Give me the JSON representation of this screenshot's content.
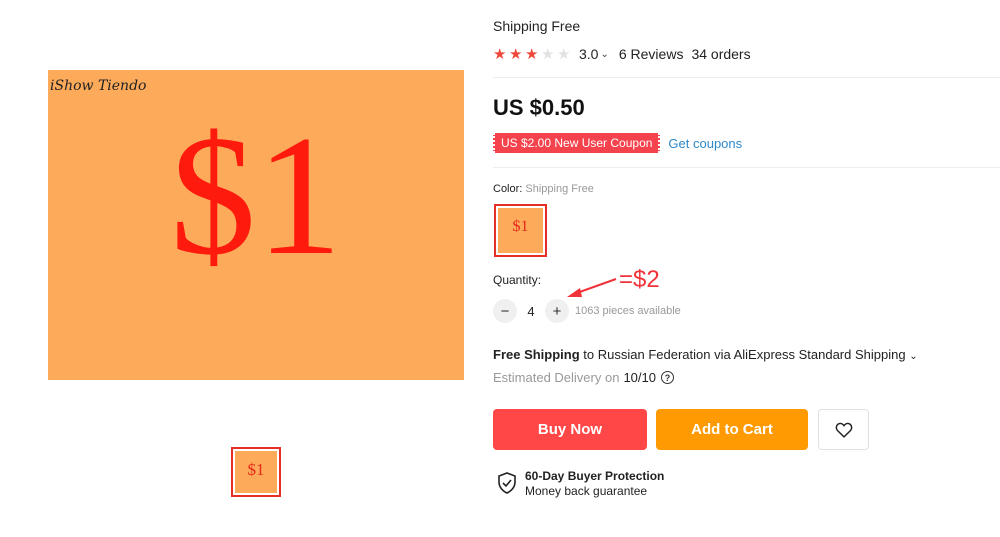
{
  "gallery": {
    "brand_text": "iShow Tiendo",
    "main_price_text": "$1",
    "thumb_price_text": "$1"
  },
  "product": {
    "title": "Shipping Free",
    "rating": {
      "stars_filled": 3,
      "stars_total": 5,
      "value": "3.0",
      "reviews": "6 Reviews",
      "orders": "34 orders"
    },
    "price": "US $0.50",
    "coupon": {
      "label": "US $2.00 New User Coupon",
      "link": "Get coupons"
    }
  },
  "color": {
    "label": "Color:",
    "value": "Shipping Free",
    "sku_text": "$1"
  },
  "quantity": {
    "label": "Quantity:",
    "minus": "−",
    "value": "4",
    "plus": "+",
    "available": "1063 pieces available",
    "annotation": "=$2"
  },
  "shipping": {
    "free_label": "Free Shipping",
    "detail": " to Russian Federation via AliExpress Standard Shipping",
    "estimated_label": "Estimated Delivery on",
    "estimated_date": "10/10"
  },
  "actions": {
    "buy_now": "Buy Now",
    "add_to_cart": "Add to Cart"
  },
  "protection": {
    "title": "60-Day Buyer Protection",
    "subtitle": "Money back guarantee"
  },
  "colors": {
    "accent_red": "#ff4747",
    "accent_orange": "#ff9a03",
    "coupon_red": "#f5434d",
    "link_blue": "#2e89c9",
    "product_orange": "#fdab5b"
  }
}
